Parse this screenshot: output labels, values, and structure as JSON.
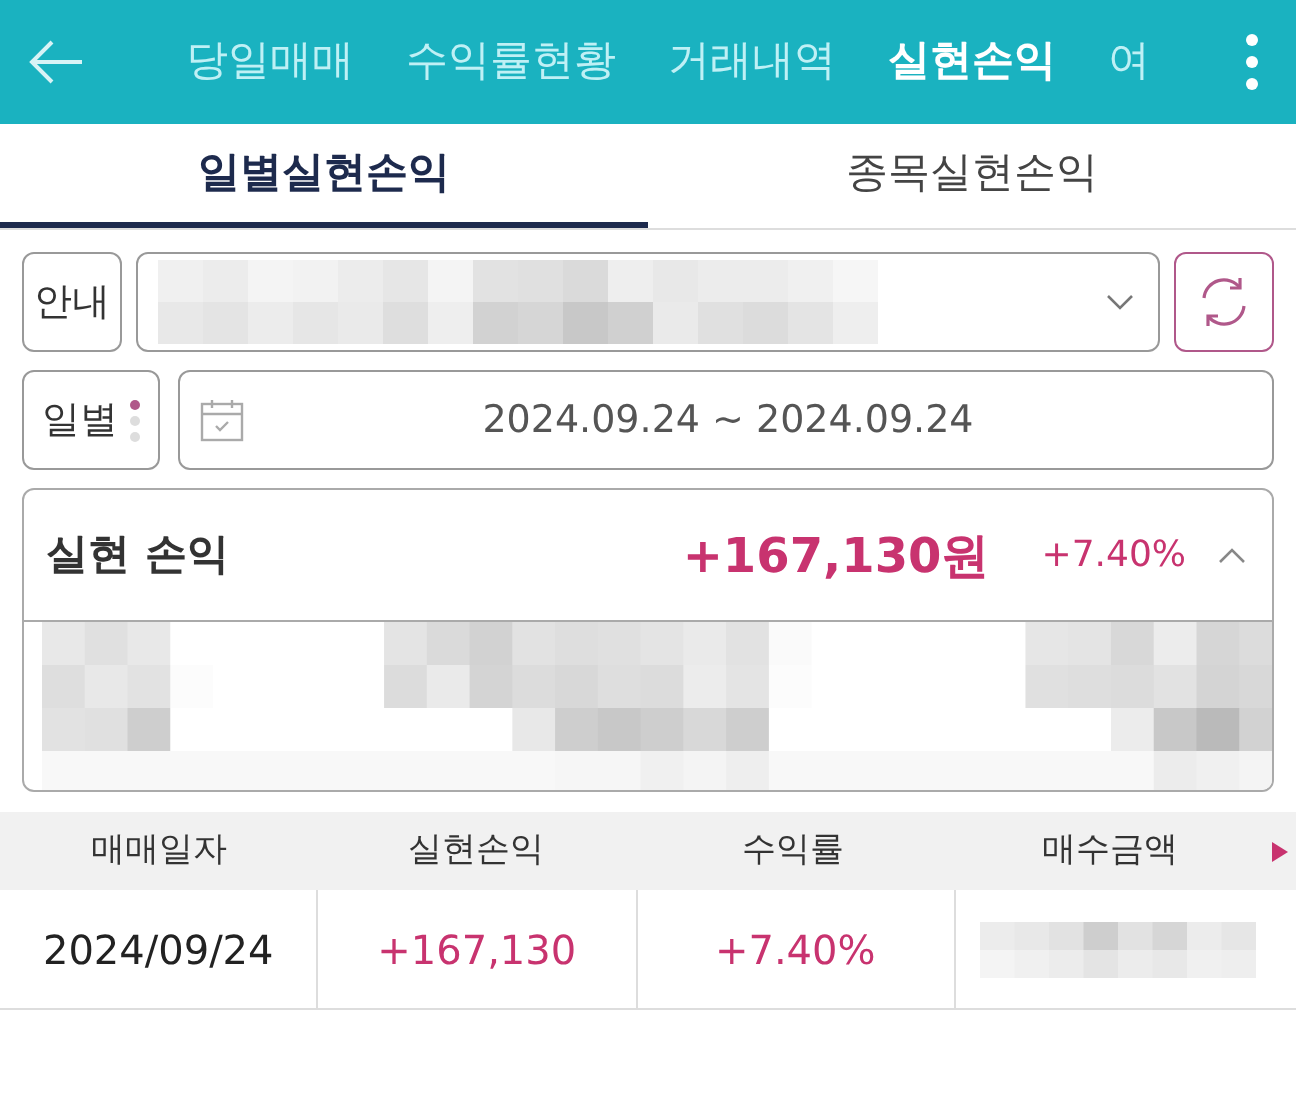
{
  "header": {
    "tabs": [
      {
        "label": "당일매매",
        "selected": false
      },
      {
        "label": "수익률현황",
        "selected": false
      },
      {
        "label": "거래내역",
        "selected": false
      },
      {
        "label": "실현손익",
        "selected": true
      },
      {
        "label": "여",
        "selected": false
      }
    ]
  },
  "sub_tabs": [
    {
      "label": "일별실현손익",
      "selected": true
    },
    {
      "label": "종목실현손익",
      "selected": false
    }
  ],
  "account": {
    "label": "안내"
  },
  "period": {
    "label": "일별",
    "page_dots": [
      {
        "selected": true
      },
      {
        "selected": false
      },
      {
        "selected": false
      }
    ],
    "range": "2024.09.24 ~ 2024.09.24"
  },
  "summary": {
    "title": "실현 손익",
    "amount": "+167,130원",
    "rate": "+7.40%",
    "expanded": true
  },
  "table": {
    "columns": [
      "매매일자",
      "실현손익",
      "수익률",
      "매수금액"
    ],
    "rows": [
      {
        "cells": [
          "2024/09/24",
          "+167,130",
          "+7.40%"
        ]
      }
    ]
  }
}
